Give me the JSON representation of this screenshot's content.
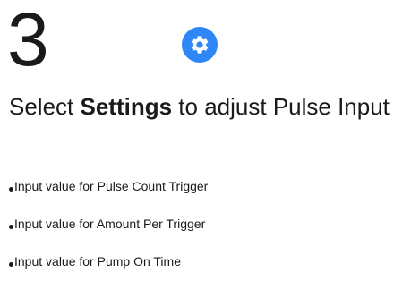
{
  "step": {
    "number": "3"
  },
  "settings_icon": {
    "color": "#2f86f6",
    "icon": "gear-icon"
  },
  "heading": {
    "prefix": "Select ",
    "emphasis": "Settings",
    "suffix": " to adjust Pulse Input"
  },
  "bullets": [
    {
      "text": "Input value for Pulse Count Trigger"
    },
    {
      "text": "Input value for Amount Per Trigger"
    },
    {
      "text": "Input value for Pump On Time"
    }
  ]
}
